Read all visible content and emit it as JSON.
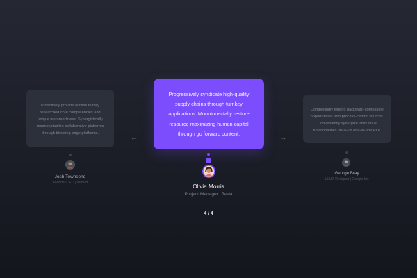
{
  "slides": {
    "left": {
      "quote": "Proactively provide access to fully researched core competencies and unique web-readiness. Synergistically reconceptualize collaborative platforms through bleeding-edge platforms.",
      "name": "Josh Townsend",
      "role": "Founder/CEO | Wizard"
    },
    "main": {
      "quote": "Progressively syndicate high-quality supply chains through turnkey applications. Monotonectally restore resource maximizing human capital through go forward content.",
      "name": "Olivia Morris",
      "role": "Project Manager | Tesla"
    },
    "right": {
      "quote": "Compellingly extend backward-compatible opportunities with process-centric sources. Conveniently synergize ubiquitous functionalities vis-a-vis one-to-one ROI.",
      "name": "George Bray",
      "role": "UI/UX Designer | Google Inc"
    }
  },
  "navigation": {
    "prev_icon": "arrow-left-icon",
    "next_icon": "arrow-right-icon",
    "prev_glyph": "←",
    "next_glyph": "→",
    "counter": "4 / 4"
  },
  "colors": {
    "accent": "#7b4dfd",
    "background": "#1b1e27",
    "side_card": "#2c303a"
  }
}
